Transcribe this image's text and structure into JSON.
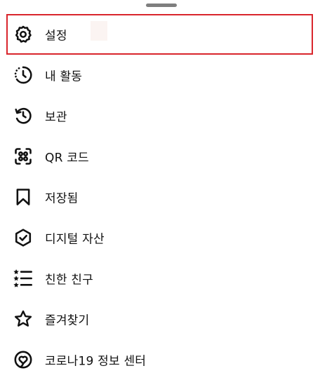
{
  "menu": {
    "items": [
      {
        "label": "설정",
        "icon": "settings-gear-icon",
        "selected": true
      },
      {
        "label": "내 활동",
        "icon": "activity-clock-icon"
      },
      {
        "label": "보관",
        "icon": "archive-history-icon"
      },
      {
        "label": "QR 코드",
        "icon": "qr-code-icon"
      },
      {
        "label": "저장됨",
        "icon": "bookmark-icon"
      },
      {
        "label": "디지털 자산",
        "icon": "digital-collectibles-hex-icon"
      },
      {
        "label": "친한 친구",
        "icon": "close-friends-list-icon"
      },
      {
        "label": "즐겨찾기",
        "icon": "favorites-star-icon"
      },
      {
        "label": "코로나19 정보 센터",
        "icon": "covid-heart-icon"
      }
    ]
  },
  "colors": {
    "highlight_border": "#d9252c",
    "text": "#111111",
    "handle": "#7f7f7f"
  }
}
